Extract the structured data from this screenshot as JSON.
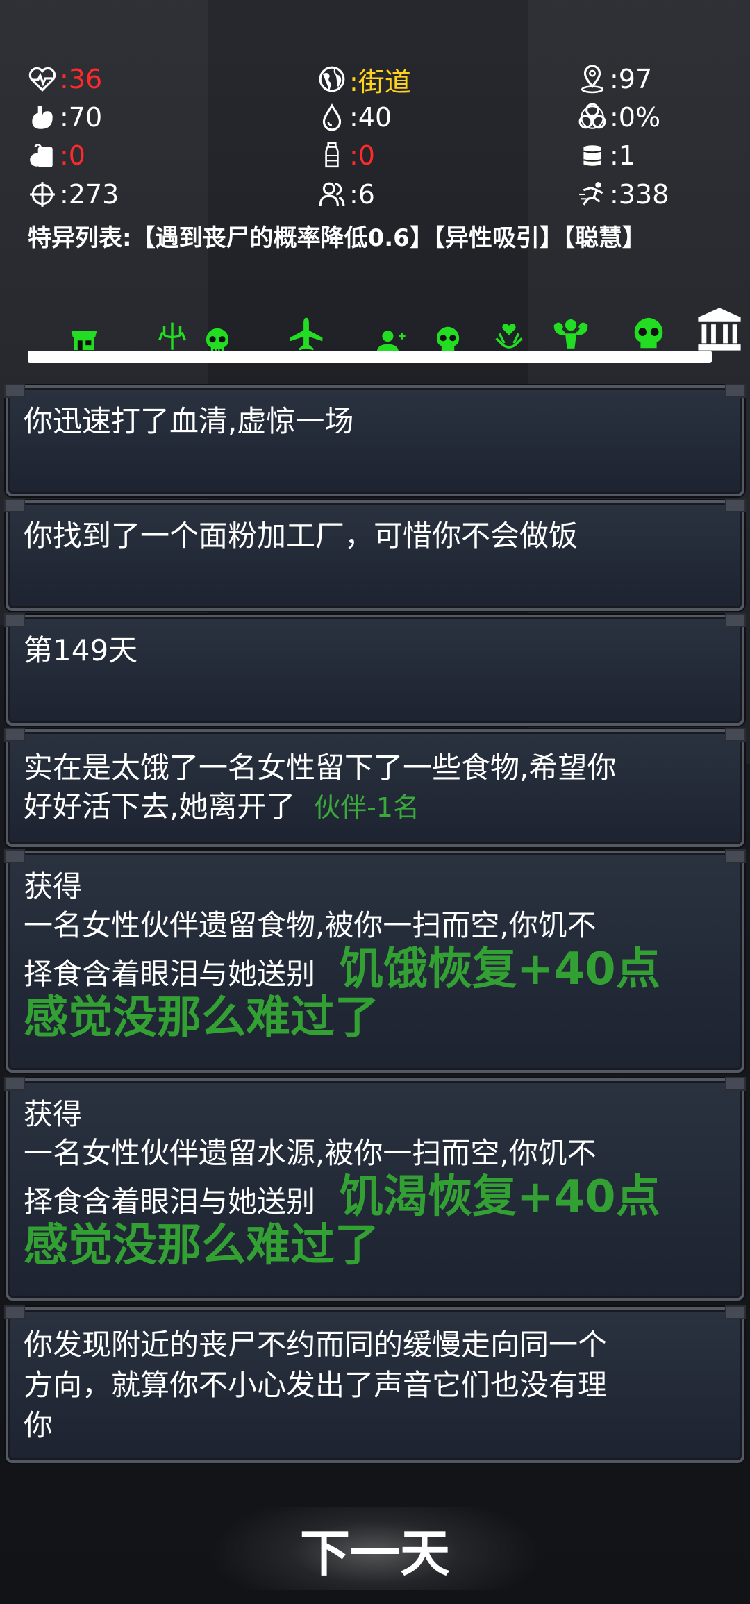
{
  "stats": [
    {
      "icon": "heartbeat-icon",
      "value": ":36",
      "color": "red"
    },
    {
      "icon": "globe-icon",
      "value": ":街道",
      "color": "yellow"
    },
    {
      "icon": "location-pin-icon",
      "value": ":97",
      "color": "white"
    },
    {
      "icon": "stomach-icon",
      "value": ":70",
      "color": "white"
    },
    {
      "icon": "water-drop-icon",
      "value": ":40",
      "color": "white"
    },
    {
      "icon": "biohazard-icon",
      "value": ":0%",
      "color": "white"
    },
    {
      "icon": "food-can-icon",
      "value": ":0",
      "color": "red"
    },
    {
      "icon": "water-bottle-icon",
      "value": ":0",
      "color": "red"
    },
    {
      "icon": "barrel-icon",
      "value": ":1",
      "color": "white"
    },
    {
      "icon": "crosshair-icon",
      "value": ":273",
      "color": "white"
    },
    {
      "icon": "group-icon",
      "value": ":6",
      "color": "white"
    },
    {
      "icon": "running-man-icon",
      "value": ":338",
      "color": "white"
    }
  ],
  "traits": "特异列表:【遇到丧尸的概率降低0.6】【异性吸引】【聪慧】",
  "progress_icons": [
    "shop-icon",
    "trident-icon",
    "skull-icon",
    "airplane-icon",
    "add-person-icon",
    "skull-icon",
    "healing-hand-icon",
    "muscle-icon",
    "skull-icon",
    "bank-icon"
  ],
  "cards": [
    {
      "lines": [
        "你迅速打了血清,虚惊一场"
      ]
    },
    {
      "lines": [
        "你找到了一个面粉加工厂，可惜你不会做饭"
      ]
    },
    {
      "lines": [
        "第149天"
      ]
    },
    {
      "lines": [
        "实在是太饿了一名女性留下了一些食物,希望你",
        "好好活下去,她离开了"
      ],
      "tag": "伙伴-1名"
    },
    {
      "lines": [
        "获得",
        "一名女性伙伴遗留食物,被你一扫而空,你饥不",
        "择食含着眼泪与她送别"
      ],
      "bonus": "饥饿恢复+40点",
      "feeling": "感觉没那么难过了"
    },
    {
      "lines": [
        "获得",
        "一名女性伙伴遗留水源,被你一扫而空,你饥不",
        "择食含着眼泪与她送别"
      ],
      "bonus": "饥渴恢复+40点",
      "feeling": "感觉没那么难过了"
    },
    {
      "lines": [
        "你发现附近的丧尸不约而同的缓慢走向同一个",
        "方向，就算你不小心发出了声音它们也没有理",
        "你"
      ]
    }
  ],
  "next_button": "下一天",
  "colors": {
    "accent_green": "#22dd22",
    "bonus_green": "#33a033",
    "danger_red": "#ff2a2a",
    "location_yellow": "#ffd21c"
  }
}
